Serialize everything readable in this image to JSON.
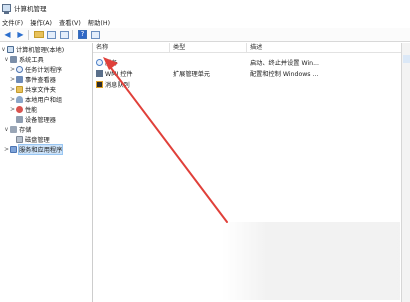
{
  "window": {
    "title": "计算机管理"
  },
  "menu": [
    "文件(F)",
    "操作(A)",
    "查看(V)",
    "帮助(H)"
  ],
  "toolbar": {
    "back_icon": "arrow-left-icon",
    "forward_icon": "arrow-right-icon"
  },
  "tree": {
    "root": "计算机管理(本地)",
    "system_tools": "系统工具",
    "task_scheduler": "任务计划程序",
    "event_viewer": "事件查看器",
    "shared_folders": "共享文件夹",
    "local_users": "本地用户和组",
    "performance": "性能",
    "device_manager": "设备管理器",
    "storage": "存储",
    "disk_management": "磁盘管理",
    "services_apps": "服务和应用程序"
  },
  "list": {
    "columns": [
      "名称",
      "类型",
      "描述"
    ],
    "rows": [
      {
        "name": "服务",
        "type": "",
        "desc": "启动、终止并设置 Win..."
      },
      {
        "name": "WMI 控件",
        "type": "扩展管理单元",
        "desc": "配置和控制 Windows ..."
      },
      {
        "name": "消息队列",
        "type": "",
        "desc": ""
      }
    ]
  },
  "colors": {
    "arrow": "#e0403a",
    "selection": "#cde3f9"
  }
}
